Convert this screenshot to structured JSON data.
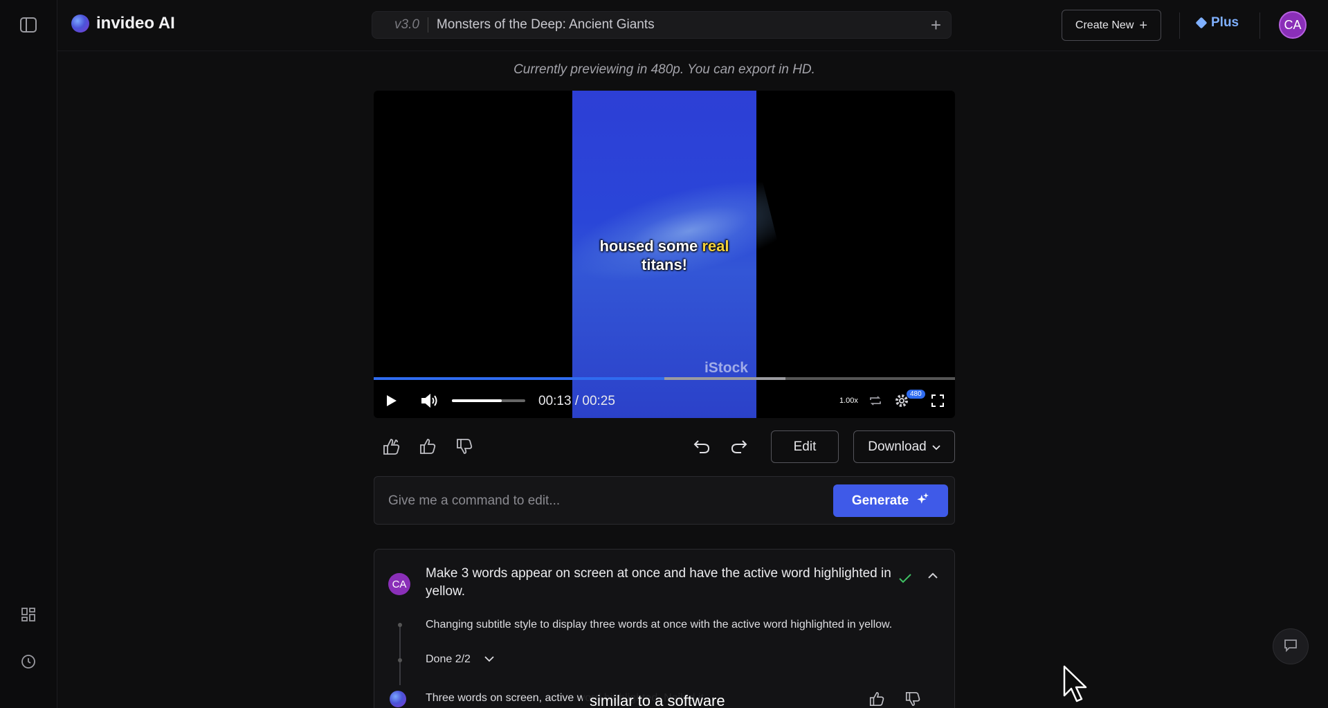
{
  "app": {
    "name": "invideo AI"
  },
  "header": {
    "version": "v3.0",
    "project_title": "Monsters of the Deep: Ancient Giants",
    "create_new_label": "Create New",
    "plan_label": "Plus",
    "user_initials": "CA"
  },
  "preview": {
    "note": "Currently previewing in 480p. You can export in HD.",
    "caption_plain": "housed some ",
    "caption_highlight": "real",
    "caption_line2": "titans!",
    "watermark": "iStock"
  },
  "player": {
    "current_time": "00:13",
    "separator": "/",
    "duration": "00:25",
    "progress_fraction": 0.5,
    "volume_fraction": 0.68,
    "speed": "1.00x",
    "resolution_badge": "480"
  },
  "actions": {
    "edit_label": "Edit",
    "download_label": "Download"
  },
  "command": {
    "placeholder": "Give me a command to edit...",
    "generate_label": "Generate"
  },
  "history": {
    "user_initials": "CA",
    "prompt": "Make 3 words appear on screen at once and have the active word highlighted in yellow.",
    "step": "Changing subtitle style to display three words at once with the active word highlighted in yellow.",
    "done_label": "Done 2/2",
    "reply": "Three words on screen, active word highlighted. Nailed it."
  },
  "overlay": {
    "subtitle": "similar to a software"
  },
  "colors": {
    "accent": "#3f5ae8",
    "progress": "#2f6cf0",
    "plus": "#7fb0ff",
    "avatar": "#8a2fb8",
    "check": "#3fbf63",
    "highlight": "#f6d33c"
  }
}
